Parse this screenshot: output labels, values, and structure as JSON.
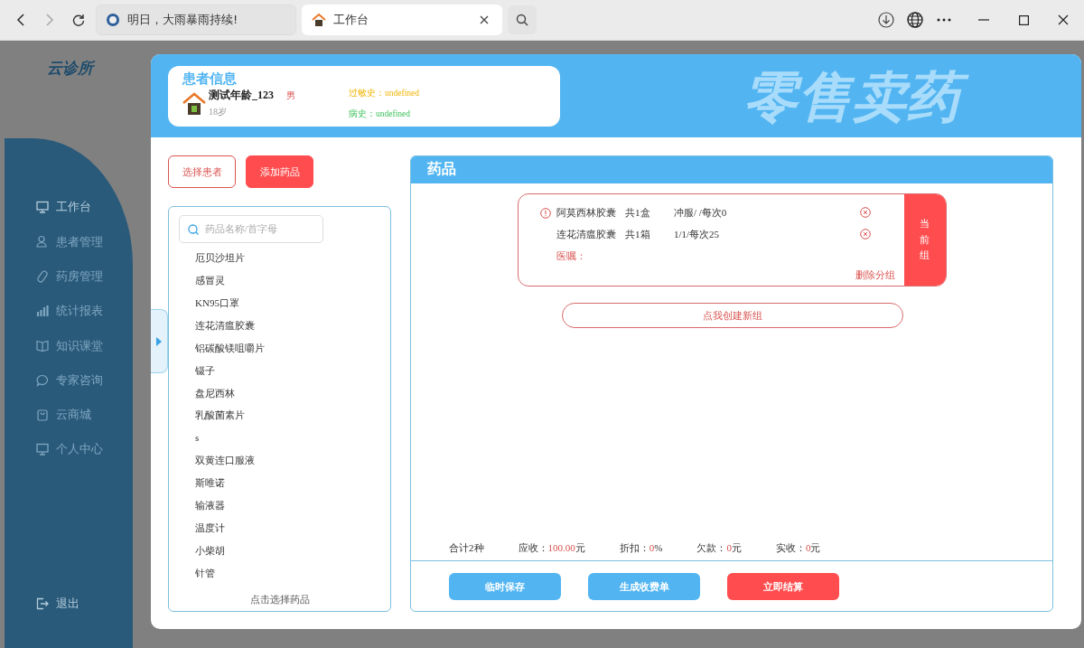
{
  "browser": {
    "tabs": [
      {
        "title": "明日，大雨暴雨持续!",
        "selected": false
      },
      {
        "title": "工作台",
        "selected": true
      }
    ]
  },
  "sidebar": {
    "logo": "云诊所",
    "items": [
      {
        "label": "工作台",
        "selected": true
      },
      {
        "label": "患者管理",
        "selected": false
      },
      {
        "label": "药房管理",
        "selected": false
      },
      {
        "label": "统计报表",
        "selected": false
      },
      {
        "label": "知识课堂",
        "selected": false
      },
      {
        "label": "专家咨询",
        "selected": false
      },
      {
        "label": "云商城",
        "selected": false
      },
      {
        "label": "个人中心",
        "selected": false
      }
    ],
    "logout": "退出"
  },
  "modal": {
    "banner": "零售卖药",
    "patient": {
      "heading": "患者信息",
      "name": "测试年龄_123",
      "gender": "男",
      "age": "18岁",
      "allergy": "过敏史：undefined",
      "history": "病史：undefined"
    },
    "actions": [
      {
        "label": "选择患者",
        "kind": "outline"
      },
      {
        "label": "添加药品",
        "kind": "filled"
      }
    ],
    "search": {
      "placeholder": "药品名称/首字母"
    },
    "drugs": [
      "厄贝沙坦片",
      "感冒灵",
      "KN95口罩",
      "连花清瘟胶囊",
      "铝碳酸镁咀嚼片",
      "镊子",
      "盘尼西林",
      "乳酸菌素片",
      "s",
      "双黄连口服液",
      "斯唯诺",
      "输液器",
      "温度计",
      "小柴胡",
      "针管"
    ],
    "list_footer": "点击选择药品",
    "panel_title": "药品",
    "group": {
      "items": [
        {
          "name": "阿莫西林胶囊",
          "qty": "共1盒",
          "usage": "冲服/ /每次0",
          "warning": true
        },
        {
          "name": "连花清瘟胶囊",
          "qty": "共1箱",
          "usage": "1/1/每次25",
          "warning": false
        }
      ],
      "note": "医嘱：",
      "delete": "删除分组",
      "tag": "当前组"
    },
    "new_group": "点我创建新组",
    "summary": [
      {
        "label": "合计2种"
      },
      {
        "label": "应收：",
        "value": "100.00",
        "unit": "元"
      },
      {
        "label": "折扣：",
        "value": "0",
        "unit": "%"
      },
      {
        "label": "欠款：",
        "value": "0",
        "unit": "元"
      },
      {
        "label": "实收：",
        "value": "0",
        "unit": "元"
      }
    ],
    "buttons": [
      {
        "label": "临时保存",
        "kind": "primary"
      },
      {
        "label": "生成收费单",
        "kind": "primary"
      },
      {
        "label": "立即结算",
        "kind": "danger"
      }
    ]
  }
}
